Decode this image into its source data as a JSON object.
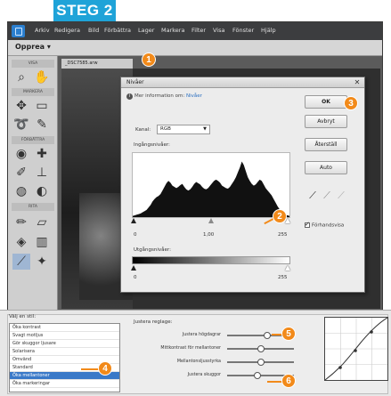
{
  "step": {
    "label": "STEG 2"
  },
  "menubar": {
    "items": [
      "Arkiv",
      "Redigera",
      "Bild",
      "Förbättra",
      "Lager",
      "Markera",
      "Filter",
      "Visa",
      "Fönster",
      "Hjälp"
    ]
  },
  "options": {
    "mode": "Opprea"
  },
  "tools": {
    "sections": [
      "VISA",
      "MARKERA",
      "FÖRBÄTTRA",
      "RITA"
    ]
  },
  "document": {
    "tab_label": "_DSC7585.arw"
  },
  "levels_dialog": {
    "title": "Nivåer",
    "info": "Mer information om:",
    "info_link": "Nivåer",
    "channel_label": "Kanal:",
    "channel_value": "RGB",
    "input_levels_label": "Ingångsnivåer:",
    "input_values": [
      "0",
      "1,00",
      "255"
    ],
    "output_levels_label": "Utgångsnivåer:",
    "output_values": [
      "0",
      "255"
    ],
    "buttons": {
      "ok": "OK",
      "cancel": "Avbryt",
      "reset": "Återställ",
      "auto": "Auto"
    },
    "preview_label": "Förhandsvisa",
    "histogram_levels": [
      0.02,
      0.03,
      0.04,
      0.05,
      0.06,
      0.08,
      0.1,
      0.12,
      0.16,
      0.2,
      0.26,
      0.3,
      0.33,
      0.35,
      0.38,
      0.44,
      0.5,
      0.56,
      0.6,
      0.57,
      0.52,
      0.5,
      0.48,
      0.5,
      0.53,
      0.55,
      0.5,
      0.46,
      0.44,
      0.46,
      0.5,
      0.55,
      0.58,
      0.56,
      0.54,
      0.5,
      0.47,
      0.46,
      0.48,
      0.52,
      0.56,
      0.6,
      0.62,
      0.6,
      0.57,
      0.52,
      0.5,
      0.48,
      0.47,
      0.5,
      0.55,
      0.6,
      0.66,
      0.74,
      0.82,
      0.92,
      0.86,
      0.76,
      0.66,
      0.6,
      0.55,
      0.52,
      0.54,
      0.58,
      0.62,
      0.6,
      0.54,
      0.48,
      0.44,
      0.4,
      0.36,
      0.3,
      0.24,
      0.18,
      0.13,
      0.09,
      0.06,
      0.04,
      0.03,
      0.02
    ]
  },
  "adjust_panel": {
    "choose_label": "Välj en stil:",
    "list_items": [
      "Öka kontrast",
      "Svagt motljus",
      "Gör skuggor ljusare",
      "Solarisera",
      "Omvänd",
      "Standard",
      "Öka mellantoner",
      "Öka markeringar"
    ],
    "selected_index": 6,
    "adjust_label": "Justera reglage:",
    "sliders": [
      {
        "label": "Justera högdagrar",
        "value": 0.6
      },
      {
        "label": "Mittkontrast för mellantoner",
        "value": 0.5
      },
      {
        "label": "Mellantonsljusstyrka",
        "value": 0.5
      },
      {
        "label": "Justera skuggor",
        "value": 0.45
      }
    ]
  },
  "callouts": [
    "1",
    "2",
    "3",
    "4",
    "5",
    "6"
  ],
  "colors": {
    "accent_orange": "#f28a1a",
    "banner_blue": "#1fa3d8",
    "selection_blue": "#3a79c8"
  }
}
